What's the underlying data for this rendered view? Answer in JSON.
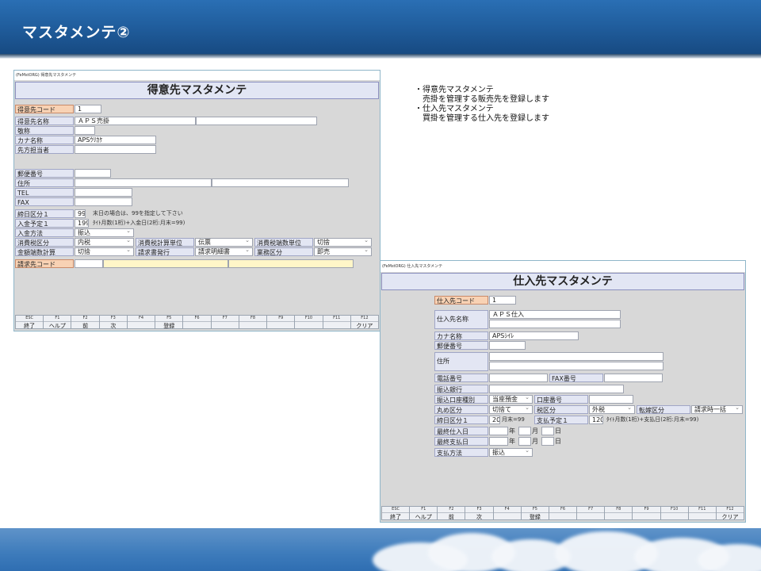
{
  "slide": {
    "title": "マスタメンテ②"
  },
  "description": {
    "lines": [
      "・得意先マスタメンテ",
      "　売掛を管理する販売先を登録します",
      "・仕入先マスタメンテ",
      "　買掛を管理する仕入先を登録します"
    ]
  },
  "customer": {
    "caption": "(FeMstORG) 得意先マスタメンテ",
    "title": "得意先マスタメンテ",
    "code_label": "得意先コード",
    "code_value": "1",
    "name_label": "得意先名称",
    "name_value": "ＡＰＳ売掛",
    "honorific_label": "敬称",
    "kana_label": "カナ名称",
    "kana_value": "APSｳﾘｶｹ",
    "contact_label": "先方担当者",
    "postal_label": "郵便番号",
    "address_label": "住所",
    "tel_label": "TEL",
    "fax_label": "FAX",
    "closing_label": "締日区分１",
    "closing_value": "99",
    "closing_note": "末日の場合は、99を指定して下さい",
    "receipt_label": "入金予定１",
    "receipt_value": "199",
    "receipt_note": "ﾀｲﾄ月数(1桁)+入金日(2桁:月末=99)",
    "method_label": "入金方法",
    "method_value": "振込",
    "tax_class_label": "消費税区分",
    "tax_class_value": "内税",
    "tax_unit_label": "消費税計算単位",
    "tax_unit_value": "伝票",
    "tax_round_label": "消費税端数単位",
    "tax_round_value": "切捨",
    "amount_round_label": "金額端数計算",
    "amount_round_value": "切捨",
    "invoice_issue_label": "請求書発行",
    "invoice_issue_value": "請求明細書",
    "business_label": "業務区分",
    "business_value": "即売",
    "billing_code_label": "請求先コード"
  },
  "supplier": {
    "caption": "(FeMstORG) 仕入先マスタメンテ",
    "title": "仕入先マスタメンテ",
    "code_label": "仕入先コード",
    "code_value": "1",
    "name_label": "仕入先名称",
    "name_value": "ＡＰＳ仕入",
    "kana_label": "カナ名称",
    "kana_value": "APSｼｲﾚ",
    "postal_label": "郵便番号",
    "address_label": "住所",
    "phone_label": "電話番号",
    "fax_label": "FAX番号",
    "bank_label": "振込銀行",
    "account_type_label": "振込口座種別",
    "account_type_value": "当座預金",
    "account_no_label": "口座番号",
    "rounding_label": "丸め区分",
    "rounding_value": "切捨て",
    "tax_label": "税区分",
    "tax_value": "外税",
    "transfer_label": "転嫁区分",
    "transfer_value": "請求時一括",
    "closing_label": "締日区分１",
    "closing_value": "20",
    "closing_note": "月末=99",
    "payment_label": "支払予定１",
    "payment_value": "120",
    "payment_note": "ﾀｲﾄ月数(1桁)+支払日(2桁:月末=99)",
    "last_purchase_label": "最終仕入日",
    "last_payment_label": "最終支払日",
    "date_year": "年",
    "date_month": "月",
    "date_day": "日",
    "pay_method_label": "支払方法",
    "pay_method_value": "振込"
  },
  "fkeys": [
    {
      "key": "ESC",
      "label": "終了"
    },
    {
      "key": "F1",
      "label": "ヘルプ"
    },
    {
      "key": "F2",
      "label": "前"
    },
    {
      "key": "F3",
      "label": "次"
    },
    {
      "key": "F4",
      "label": ""
    },
    {
      "key": "F5",
      "label": "登録"
    },
    {
      "key": "F6",
      "label": ""
    },
    {
      "key": "F7",
      "label": ""
    },
    {
      "key": "F8",
      "label": ""
    },
    {
      "key": "F9",
      "label": ""
    },
    {
      "key": "F10",
      "label": ""
    },
    {
      "key": "F11",
      "label": ""
    },
    {
      "key": "F12",
      "label": "クリア"
    }
  ]
}
